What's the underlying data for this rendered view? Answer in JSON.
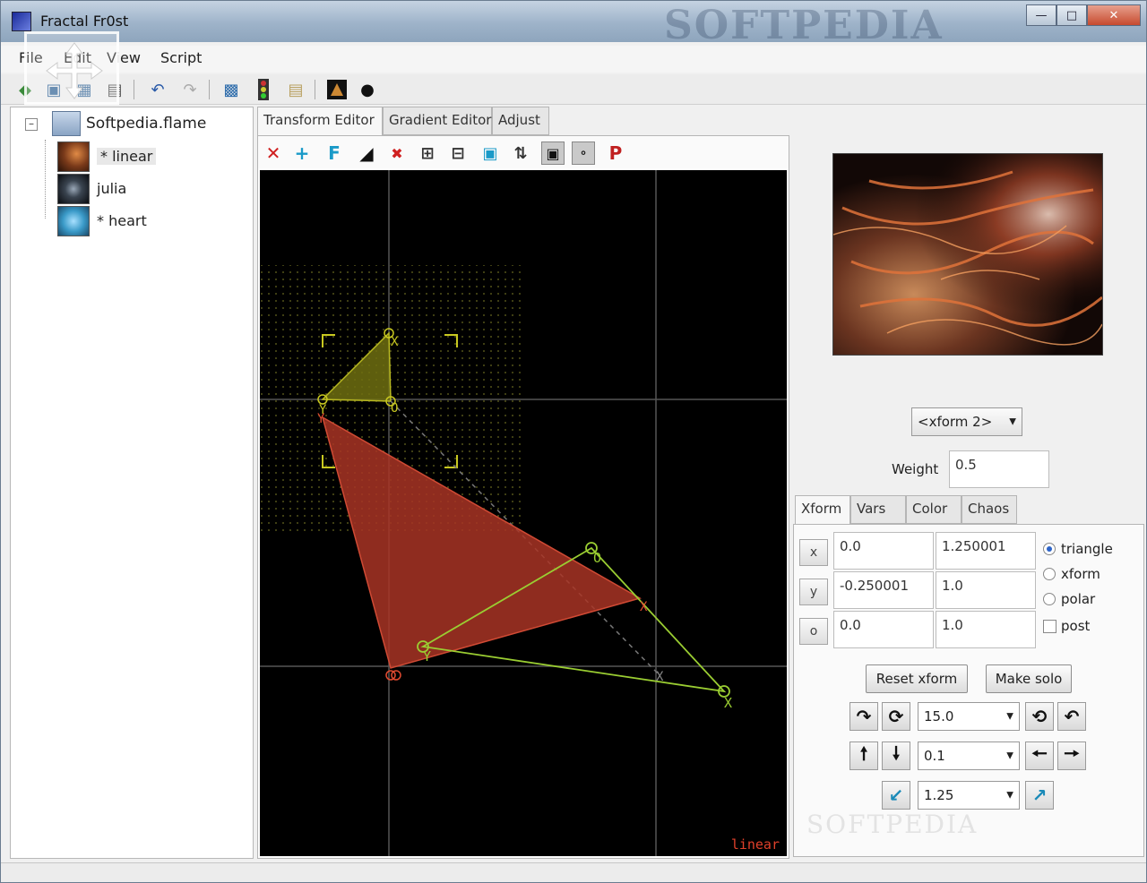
{
  "window": {
    "title": "Fractal Fr0st",
    "watermark": "SOFTPEDIA"
  },
  "menu": [
    "File",
    "Edit",
    "View",
    "Script"
  ],
  "tree": {
    "root": "Softpedia.flame",
    "items": [
      {
        "label": "* linear",
        "selected": true
      },
      {
        "label": "julia",
        "selected": false
      },
      {
        "label": "* heart",
        "selected": false
      }
    ]
  },
  "editor_tabs": [
    "Transform Editor",
    "Gradient Editor",
    "Adjust"
  ],
  "canvas": {
    "caption": "linear"
  },
  "xform_selector": {
    "value": "<xform 2>"
  },
  "weight": {
    "label": "Weight",
    "value": "0.5"
  },
  "sub_tabs": [
    "Xform",
    "Vars",
    "Color",
    "Chaos"
  ],
  "coeffs": {
    "rows": [
      {
        "button": "x",
        "a": "0.0",
        "b": "1.250001"
      },
      {
        "button": "y",
        "a": "-0.250001",
        "b": "1.0"
      },
      {
        "button": "o",
        "a": "0.0",
        "b": "1.0"
      }
    ]
  },
  "coord_mode": {
    "options": [
      "triangle",
      "xform",
      "polar"
    ],
    "selected": "triangle",
    "post_label": "post"
  },
  "buttons": {
    "reset": "Reset xform",
    "solo": "Make solo"
  },
  "rotate_combo": "15.0",
  "move_combo": "0.1",
  "scale_combo": "1.25",
  "colors": {
    "triangle_main": "#b03a2a",
    "triangle_ref": "#8a8a1a",
    "handle_green": "#9acd32",
    "caption_red": "#e0402a"
  },
  "icons": {
    "toolbar": [
      "new-icon",
      "open-icon",
      "save-icon",
      "save-as-icon",
      "undo-icon",
      "redo-icon",
      "render-icon",
      "traffic-light-icon",
      "notes-icon",
      "preview-icon",
      "zoom-icon"
    ],
    "editor": [
      "delete-xform-icon",
      "add-xform-icon",
      "final-xform-icon",
      "triangle-icon",
      "clear-icon",
      "zoom-in-icon",
      "zoom-out-icon",
      "zoom-fit-icon",
      "flip-icon",
      "lock-icon",
      "grid-icon",
      "post-icon"
    ]
  }
}
